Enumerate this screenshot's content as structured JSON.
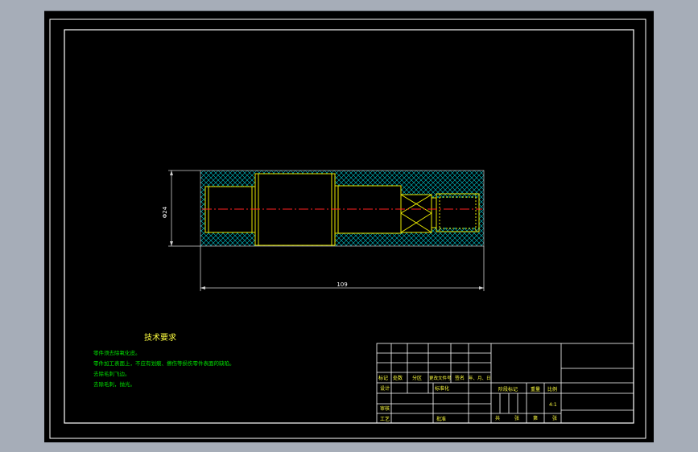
{
  "drawing": {
    "dimensions": {
      "length": "109",
      "diameter": "Φ24"
    },
    "notes": {
      "title": "技术要求",
      "lines": [
        "零件须去除氧化皮。",
        "零件加工表面上，不应有划痕、擦伤等损伤零件表面的缺陷。",
        "去除毛刺飞边。",
        "去除毛刺，抛光。"
      ]
    },
    "title_block": {
      "header_cells": [
        "标记",
        "处数",
        "分区",
        "更改文件号",
        "签名",
        "年、月、日"
      ],
      "row_design": "设计",
      "row_standard": "标准化",
      "row_review": "审核",
      "row_process": "工艺",
      "row_approve": "批准",
      "stage_label": "阶段标记",
      "weight_label": "重量",
      "scale_label": "比例",
      "scale_value": "4:1",
      "sheets_label": "共",
      "sheets_unit": "张",
      "sheet_label": "第",
      "sheet_unit": "张"
    }
  },
  "colors": {
    "background": "#000000",
    "outline": "#e8e800",
    "centerline": "#ff2020",
    "hatch": "#00c8d0",
    "text": "#00e000"
  }
}
